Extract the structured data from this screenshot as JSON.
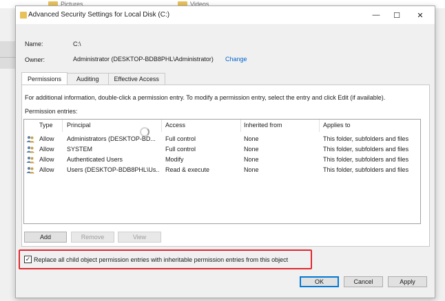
{
  "background": {
    "items": [
      {
        "label": "Pictures",
        "icon": "folder-icon"
      },
      {
        "label": "Videos",
        "icon": "folder-icon"
      }
    ]
  },
  "window": {
    "title": "Advanced Security Settings for Local Disk (C:)",
    "minimize": "—",
    "maximize": "☐",
    "close": "✕"
  },
  "info": {
    "name_label": "Name:",
    "name_value": "C:\\",
    "owner_label": "Owner:",
    "owner_value": "Administrator (DESKTOP-BDB8PHL\\Administrator)",
    "change_link": "Change"
  },
  "tabs": [
    "Permissions",
    "Auditing",
    "Effective Access"
  ],
  "active_tab": "Permissions",
  "instructions": "For additional information, double-click a permission entry. To modify a permission entry, select the entry and click Edit (if available).",
  "entries_label": "Permission entries:",
  "columns": {
    "type": "Type",
    "principal": "Principal",
    "access": "Access",
    "inherited": "Inherited from",
    "applies": "Applies to"
  },
  "rows": [
    {
      "type": "Allow",
      "principal": "Administrators (DESKTOP-BD...",
      "access": "Full control",
      "inherited": "None",
      "applies": "This folder, subfolders and files"
    },
    {
      "type": "Allow",
      "principal": "SYSTEM",
      "access": "Full control",
      "inherited": "None",
      "applies": "This folder, subfolders and files"
    },
    {
      "type": "Allow",
      "principal": "Authenticated Users",
      "access": "Modify",
      "inherited": "None",
      "applies": "This folder, subfolders and files"
    },
    {
      "type": "Allow",
      "principal": "Users (DESKTOP-BDB8PHL\\Us...",
      "access": "Read & execute",
      "inherited": "None",
      "applies": "This folder, subfolders and files"
    }
  ],
  "buttons": {
    "add": "Add",
    "remove": "Remove",
    "view": "View",
    "ok": "OK",
    "cancel": "Cancel",
    "apply": "Apply"
  },
  "checkbox": {
    "label": "Replace all child object permission entries with inheritable permission entries from this object",
    "checked": true,
    "mark": "✓"
  },
  "colors": {
    "highlight": "#e0262d",
    "link": "#0066cc",
    "accent": "#0078d7"
  }
}
